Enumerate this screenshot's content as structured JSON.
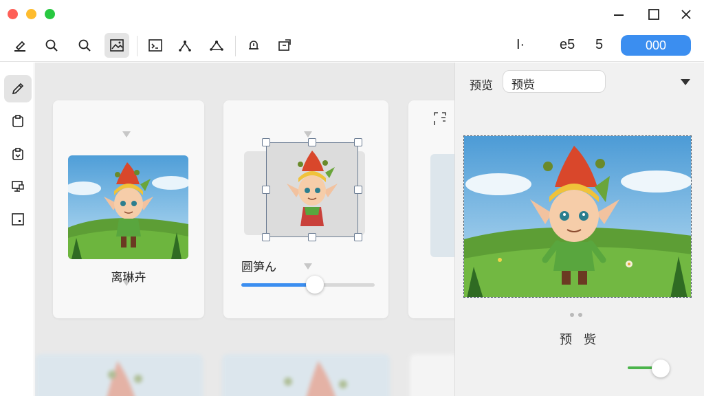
{
  "toolbar": {
    "right_text_1": "I·",
    "right_text_2": "e5",
    "right_text_3": "5",
    "primary_label": "000"
  },
  "workspace": {
    "card1_caption": "离琳卉",
    "card2_caption": "圆笋ん"
  },
  "slider": {
    "value": 0.55
  },
  "panel": {
    "label": "预览",
    "select_value": "预赀",
    "preview_caption": "预 赀"
  },
  "toggle": {
    "state": "on"
  },
  "colors": {
    "accent": "#3b8ef0",
    "toggle_on": "#4bb44b"
  }
}
